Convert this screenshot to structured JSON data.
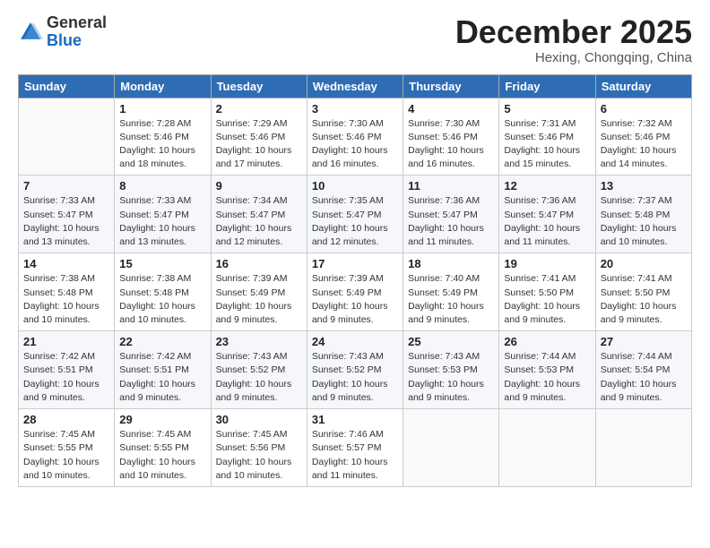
{
  "logo": {
    "general": "General",
    "blue": "Blue"
  },
  "header": {
    "month": "December 2025",
    "location": "Hexing, Chongqing, China"
  },
  "days_of_week": [
    "Sunday",
    "Monday",
    "Tuesday",
    "Wednesday",
    "Thursday",
    "Friday",
    "Saturday"
  ],
  "weeks": [
    [
      {
        "day": "",
        "sunrise": "",
        "sunset": "",
        "daylight": ""
      },
      {
        "day": "1",
        "sunrise": "Sunrise: 7:28 AM",
        "sunset": "Sunset: 5:46 PM",
        "daylight": "Daylight: 10 hours and 18 minutes."
      },
      {
        "day": "2",
        "sunrise": "Sunrise: 7:29 AM",
        "sunset": "Sunset: 5:46 PM",
        "daylight": "Daylight: 10 hours and 17 minutes."
      },
      {
        "day": "3",
        "sunrise": "Sunrise: 7:30 AM",
        "sunset": "Sunset: 5:46 PM",
        "daylight": "Daylight: 10 hours and 16 minutes."
      },
      {
        "day": "4",
        "sunrise": "Sunrise: 7:30 AM",
        "sunset": "Sunset: 5:46 PM",
        "daylight": "Daylight: 10 hours and 16 minutes."
      },
      {
        "day": "5",
        "sunrise": "Sunrise: 7:31 AM",
        "sunset": "Sunset: 5:46 PM",
        "daylight": "Daylight: 10 hours and 15 minutes."
      },
      {
        "day": "6",
        "sunrise": "Sunrise: 7:32 AM",
        "sunset": "Sunset: 5:46 PM",
        "daylight": "Daylight: 10 hours and 14 minutes."
      }
    ],
    [
      {
        "day": "7",
        "sunrise": "Sunrise: 7:33 AM",
        "sunset": "Sunset: 5:47 PM",
        "daylight": "Daylight: 10 hours and 13 minutes."
      },
      {
        "day": "8",
        "sunrise": "Sunrise: 7:33 AM",
        "sunset": "Sunset: 5:47 PM",
        "daylight": "Daylight: 10 hours and 13 minutes."
      },
      {
        "day": "9",
        "sunrise": "Sunrise: 7:34 AM",
        "sunset": "Sunset: 5:47 PM",
        "daylight": "Daylight: 10 hours and 12 minutes."
      },
      {
        "day": "10",
        "sunrise": "Sunrise: 7:35 AM",
        "sunset": "Sunset: 5:47 PM",
        "daylight": "Daylight: 10 hours and 12 minutes."
      },
      {
        "day": "11",
        "sunrise": "Sunrise: 7:36 AM",
        "sunset": "Sunset: 5:47 PM",
        "daylight": "Daylight: 10 hours and 11 minutes."
      },
      {
        "day": "12",
        "sunrise": "Sunrise: 7:36 AM",
        "sunset": "Sunset: 5:47 PM",
        "daylight": "Daylight: 10 hours and 11 minutes."
      },
      {
        "day": "13",
        "sunrise": "Sunrise: 7:37 AM",
        "sunset": "Sunset: 5:48 PM",
        "daylight": "Daylight: 10 hours and 10 minutes."
      }
    ],
    [
      {
        "day": "14",
        "sunrise": "Sunrise: 7:38 AM",
        "sunset": "Sunset: 5:48 PM",
        "daylight": "Daylight: 10 hours and 10 minutes."
      },
      {
        "day": "15",
        "sunrise": "Sunrise: 7:38 AM",
        "sunset": "Sunset: 5:48 PM",
        "daylight": "Daylight: 10 hours and 10 minutes."
      },
      {
        "day": "16",
        "sunrise": "Sunrise: 7:39 AM",
        "sunset": "Sunset: 5:49 PM",
        "daylight": "Daylight: 10 hours and 9 minutes."
      },
      {
        "day": "17",
        "sunrise": "Sunrise: 7:39 AM",
        "sunset": "Sunset: 5:49 PM",
        "daylight": "Daylight: 10 hours and 9 minutes."
      },
      {
        "day": "18",
        "sunrise": "Sunrise: 7:40 AM",
        "sunset": "Sunset: 5:49 PM",
        "daylight": "Daylight: 10 hours and 9 minutes."
      },
      {
        "day": "19",
        "sunrise": "Sunrise: 7:41 AM",
        "sunset": "Sunset: 5:50 PM",
        "daylight": "Daylight: 10 hours and 9 minutes."
      },
      {
        "day": "20",
        "sunrise": "Sunrise: 7:41 AM",
        "sunset": "Sunset: 5:50 PM",
        "daylight": "Daylight: 10 hours and 9 minutes."
      }
    ],
    [
      {
        "day": "21",
        "sunrise": "Sunrise: 7:42 AM",
        "sunset": "Sunset: 5:51 PM",
        "daylight": "Daylight: 10 hours and 9 minutes."
      },
      {
        "day": "22",
        "sunrise": "Sunrise: 7:42 AM",
        "sunset": "Sunset: 5:51 PM",
        "daylight": "Daylight: 10 hours and 9 minutes."
      },
      {
        "day": "23",
        "sunrise": "Sunrise: 7:43 AM",
        "sunset": "Sunset: 5:52 PM",
        "daylight": "Daylight: 10 hours and 9 minutes."
      },
      {
        "day": "24",
        "sunrise": "Sunrise: 7:43 AM",
        "sunset": "Sunset: 5:52 PM",
        "daylight": "Daylight: 10 hours and 9 minutes."
      },
      {
        "day": "25",
        "sunrise": "Sunrise: 7:43 AM",
        "sunset": "Sunset: 5:53 PM",
        "daylight": "Daylight: 10 hours and 9 minutes."
      },
      {
        "day": "26",
        "sunrise": "Sunrise: 7:44 AM",
        "sunset": "Sunset: 5:53 PM",
        "daylight": "Daylight: 10 hours and 9 minutes."
      },
      {
        "day": "27",
        "sunrise": "Sunrise: 7:44 AM",
        "sunset": "Sunset: 5:54 PM",
        "daylight": "Daylight: 10 hours and 9 minutes."
      }
    ],
    [
      {
        "day": "28",
        "sunrise": "Sunrise: 7:45 AM",
        "sunset": "Sunset: 5:55 PM",
        "daylight": "Daylight: 10 hours and 10 minutes."
      },
      {
        "day": "29",
        "sunrise": "Sunrise: 7:45 AM",
        "sunset": "Sunset: 5:55 PM",
        "daylight": "Daylight: 10 hours and 10 minutes."
      },
      {
        "day": "30",
        "sunrise": "Sunrise: 7:45 AM",
        "sunset": "Sunset: 5:56 PM",
        "daylight": "Daylight: 10 hours and 10 minutes."
      },
      {
        "day": "31",
        "sunrise": "Sunrise: 7:46 AM",
        "sunset": "Sunset: 5:57 PM",
        "daylight": "Daylight: 10 hours and 11 minutes."
      },
      {
        "day": "",
        "sunrise": "",
        "sunset": "",
        "daylight": ""
      },
      {
        "day": "",
        "sunrise": "",
        "sunset": "",
        "daylight": ""
      },
      {
        "day": "",
        "sunrise": "",
        "sunset": "",
        "daylight": ""
      }
    ]
  ]
}
